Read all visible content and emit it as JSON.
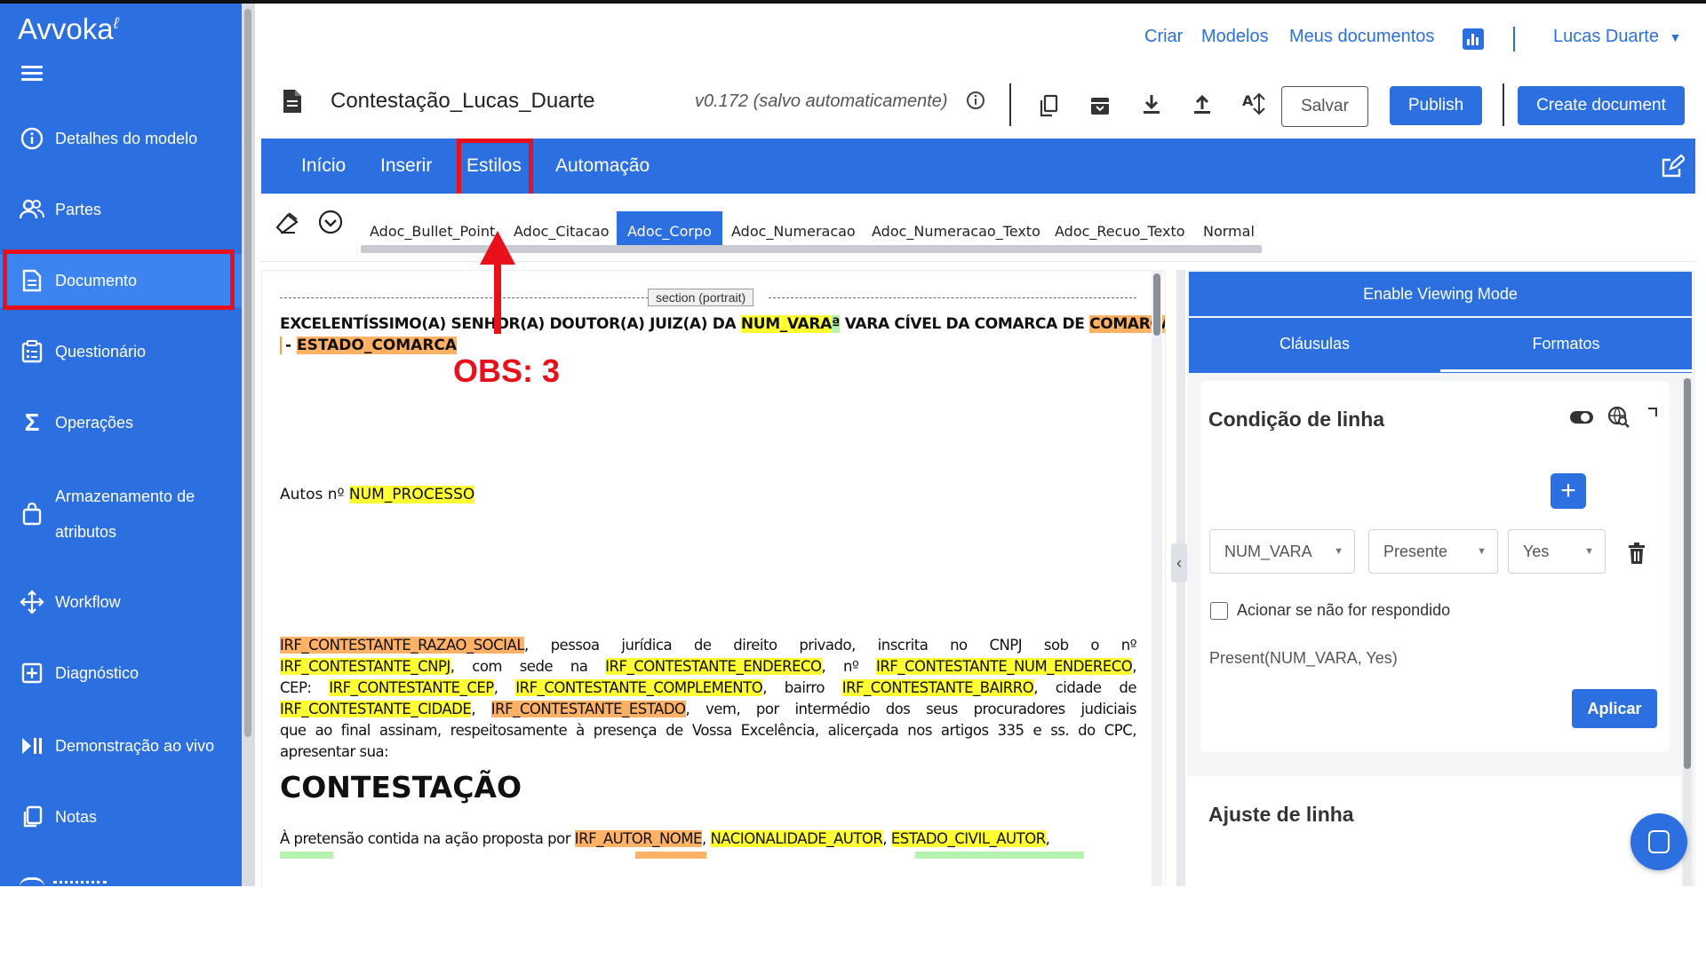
{
  "app": {
    "logo": "Avvoka"
  },
  "sidebar": {
    "items": [
      {
        "label": "Detalhes do modelo",
        "icon": "info-icon"
      },
      {
        "label": "Partes",
        "icon": "users-icon"
      },
      {
        "label": "Documento",
        "icon": "document-icon",
        "active": true
      },
      {
        "label": "Questionário",
        "icon": "clipboard-icon"
      },
      {
        "label": "Operações",
        "icon": "sigma-icon"
      },
      {
        "label_line1": "Armazenamento de",
        "label_line2": "atributos",
        "icon": "bag-icon"
      },
      {
        "label": "Workflow",
        "icon": "move-icon"
      },
      {
        "label": "Diagnóstico",
        "icon": "plus-square-icon"
      },
      {
        "label": "Demonstração ao vivo",
        "icon": "play-pause-icon"
      },
      {
        "label": "Notas",
        "icon": "copy-icon"
      }
    ]
  },
  "header": {
    "nav": [
      "Criar",
      "Modelos",
      "Meus documentos"
    ],
    "user": "Lucas Duarte"
  },
  "toolbar": {
    "title": "Contestação_Lucas_Duarte",
    "version": "v0.172 (salvo automaticamente)",
    "save_label": "Salvar",
    "publish_label": "Publish",
    "create_label": "Create document"
  },
  "ribbon": {
    "tabs": [
      "Início",
      "Inserir",
      "Estilos",
      "Automação"
    ],
    "active_tab": "Estilos"
  },
  "styles": {
    "items": [
      "Adoc_Bullet_Point",
      "Adoc_Citacao",
      "Adoc_Corpo",
      "Adoc_Numeracao",
      "Adoc_Numeracao_Texto",
      "Adoc_Recuo_Texto",
      "Normal"
    ],
    "active": "Adoc_Corpo"
  },
  "document": {
    "section_tag": "section (portrait)",
    "p1": {
      "t1": "EXCELENTÍSSIMO(A) SENHOR(A) DOUTOR(A) JUIZ(A) DA ",
      "num_vara": "NUM_VARA",
      "ord": "ª",
      "t2": " VARA CÍVEL DA COMARCA DE ",
      "comarca": "COMARCA",
      "t3": " - ",
      "estado": "ESTADO_COMARCA"
    },
    "p2": {
      "t1": "Autos nº ",
      "num_processo": "NUM_PROCESSO"
    },
    "p3": {
      "razao": "IRF_CONTESTANTE_RAZAO_SOCIAL",
      "t1": ", pessoa jurídica de direito privado, inscrita no CNPJ sob o nº",
      "cnpj": "IRF_CONTESTANTE_CNPJ",
      "t2": ", com sede na ",
      "endereco": "IRF_CONTESTANTE_ENDERECO",
      "t3": ", nº ",
      "num_end": "IRF_CONTESTANTE_NUM_ENDERECO",
      "t4": ",",
      "t5": "CEP: ",
      "cep": "IRF_CONTESTANTE_CEP",
      "t6": ", ",
      "complemento": "IRF_CONTESTANTE_COMPLEMENTO",
      "t7": ", bairro ",
      "bairro": "IRF_CONTESTANTE_BAIRRO",
      "t8": ", cidade de",
      "cidade": "IRF_CONTESTANTE_CIDADE",
      "t9": ", ",
      "estado": "IRF_CONTESTANTE_ESTADO",
      "t10": ", vem, por intermédio dos seus procuradores judiciais",
      "line5": "que ao final assinam, respeitosamente à presença de Vossa Excelência, alicerçada nos artigos 335 e ss. do CPC,",
      "line6": "apresentar sua:"
    },
    "heading": "CONTESTAÇÃO",
    "p4": {
      "t1": "À pretensão contida na ação proposta por ",
      "autor_nome": "IRF_AUTOR_NOME",
      "t2": ", ",
      "nacionalidade": "NACIONALIDADE_AUTOR",
      "t3": ", ",
      "estado_civil": "ESTADO_CIVIL_AUTOR",
      "t4": ","
    }
  },
  "panel": {
    "enable_viewing": "Enable Viewing Mode",
    "tabs": [
      "Cláusulas",
      "Formatos"
    ],
    "card_title": "Condição de linha",
    "selects": [
      "NUM_VARA",
      "Presente",
      "Yes"
    ],
    "checkbox_label": "Acionar se não for respondido",
    "expression": "Present(NUM_VARA, Yes)",
    "apply_label": "Aplicar",
    "second_title": "Ajuste de linha"
  },
  "annotation": {
    "text": "OBS: 3"
  },
  "colors": {
    "primary": "#2b6fe0",
    "annotation": "#e8101a",
    "highlight_yellow": "#ffff33",
    "highlight_orange": "#ffb266",
    "highlight_green": "#b6f2b0"
  }
}
